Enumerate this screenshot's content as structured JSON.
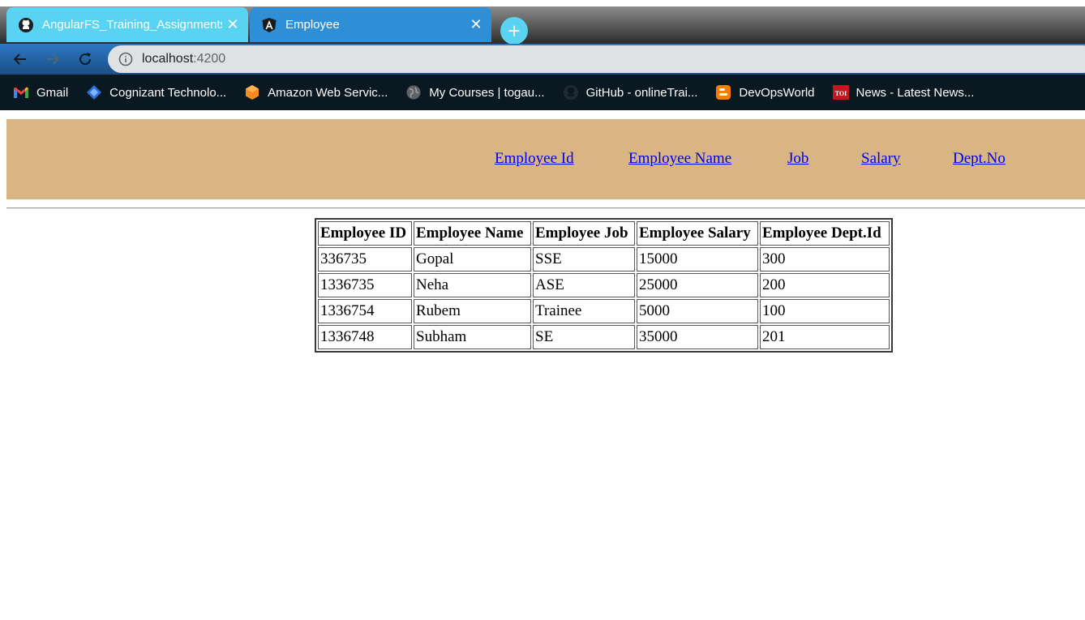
{
  "browser": {
    "tabs": [
      {
        "title": "AngularFS_Training_Assignments",
        "favicon": "github-icon",
        "active": false
      },
      {
        "title": "Employee",
        "favicon": "angular-icon",
        "active": true
      }
    ],
    "new_tab": "+",
    "address": {
      "host": "localhost",
      "port": ":4200"
    },
    "bookmarks": [
      {
        "label": "Gmail",
        "icon": "gmail-icon"
      },
      {
        "label": "Cognizant Technolo...",
        "icon": "cognizant-icon"
      },
      {
        "label": "Amazon Web Servic...",
        "icon": "aws-icon"
      },
      {
        "label": "My Courses | togau...",
        "icon": "globe-icon"
      },
      {
        "label": "GitHub - onlineTrai...",
        "icon": "github-icon"
      },
      {
        "label": "DevOpsWorld",
        "icon": "blogger-icon"
      },
      {
        "label": "News - Latest News...",
        "icon": "toi-icon"
      }
    ],
    "colors": {
      "tab_inactive": "#5ad3f2",
      "tab_active": "#2f8fd6",
      "toolbar": "#2c78c4",
      "bookmarks_bar": "#0a1822"
    }
  },
  "page": {
    "nav": {
      "links": [
        "Employee Id",
        "Employee Name",
        "Job",
        "Salary",
        "Dept.No"
      ],
      "background": "#d9b584"
    },
    "table": {
      "headers": [
        "Employee ID",
        "Employee Name",
        "Employee Job",
        "Employee Salary",
        "Employee Dept.Id"
      ],
      "rows": [
        [
          "336735",
          "Gopal",
          "SSE",
          "15000",
          "300"
        ],
        [
          "1336735",
          "Neha",
          "ASE",
          "25000",
          "200"
        ],
        [
          "1336754",
          "Rubem",
          "Trainee",
          "5000",
          "100"
        ],
        [
          "1336748",
          "Subham",
          "SE",
          "35000",
          "201"
        ]
      ]
    }
  }
}
